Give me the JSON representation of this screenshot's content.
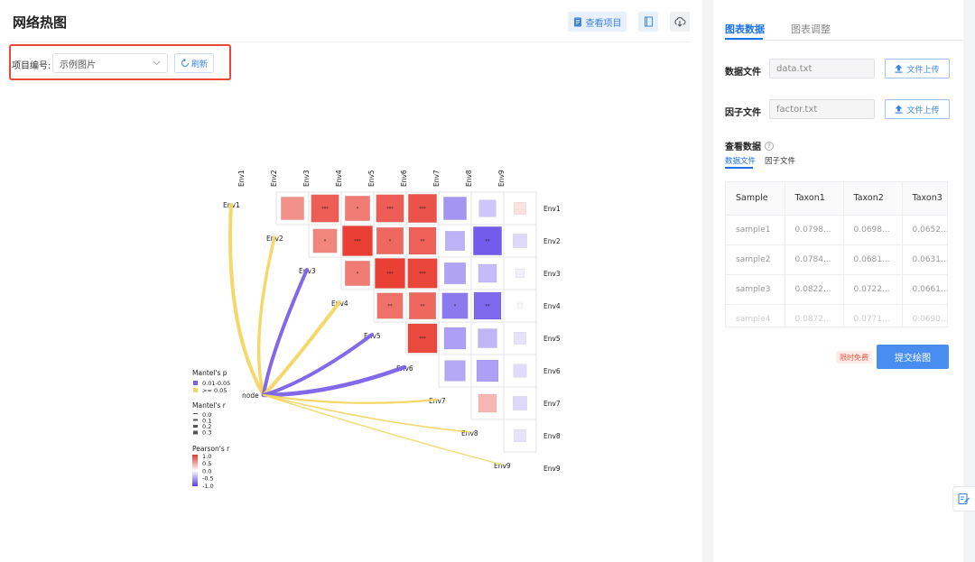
{
  "page": {
    "title": "网络热图"
  },
  "toolbar": {
    "view_project": "查看项目"
  },
  "project": {
    "label": "项目编号:",
    "selected": "示例图片",
    "refresh": "刷新"
  },
  "plot": {
    "env_labels": [
      "Env1",
      "Env2",
      "Env3",
      "Env4",
      "Env5",
      "Env6",
      "Env7",
      "Env8",
      "Env9"
    ],
    "node_label": "node",
    "legend": {
      "mantel_p_title": "Mantel's p",
      "mantel_p_items": [
        {
          "label": "0.01-0.05",
          "color": "#7b61e8"
        },
        {
          "label": ">= 0.05",
          "color": "#f5d561"
        }
      ],
      "mantel_r_title": "Mantel's r",
      "mantel_r_items": [
        "0.0",
        "0.1",
        "0.2",
        "0.3"
      ],
      "pearson_title": "Pearson's r",
      "pearson_ticks": [
        "1.0",
        "0.5",
        "0.0",
        "-0.5",
        "-1.0"
      ]
    },
    "cells": [
      {
        "row": 0,
        "col": 1,
        "r": 0.55,
        "sig": ""
      },
      {
        "row": 0,
        "col": 2,
        "r": 0.8,
        "sig": "***"
      },
      {
        "row": 0,
        "col": 3,
        "r": 0.65,
        "sig": "*"
      },
      {
        "row": 0,
        "col": 4,
        "r": 0.8,
        "sig": "***"
      },
      {
        "row": 0,
        "col": 5,
        "r": 0.85,
        "sig": "***"
      },
      {
        "row": 0,
        "col": 6,
        "r": -0.55,
        "sig": ""
      },
      {
        "row": 0,
        "col": 7,
        "r": -0.3,
        "sig": ""
      },
      {
        "row": 0,
        "col": 8,
        "r": 0.15,
        "sig": ""
      },
      {
        "row": 1,
        "col": 2,
        "r": 0.6,
        "sig": "*"
      },
      {
        "row": 1,
        "col": 3,
        "r": 0.95,
        "sig": "***"
      },
      {
        "row": 1,
        "col": 4,
        "r": 0.75,
        "sig": "*"
      },
      {
        "row": 1,
        "col": 5,
        "r": 0.78,
        "sig": "**"
      },
      {
        "row": 1,
        "col": 6,
        "r": -0.4,
        "sig": ""
      },
      {
        "row": 1,
        "col": 7,
        "r": -0.85,
        "sig": "**"
      },
      {
        "row": 1,
        "col": 8,
        "r": -0.2,
        "sig": ""
      },
      {
        "row": 2,
        "col": 3,
        "r": 0.65,
        "sig": "*"
      },
      {
        "row": 2,
        "col": 4,
        "r": 0.95,
        "sig": "***"
      },
      {
        "row": 2,
        "col": 5,
        "r": 0.92,
        "sig": "***"
      },
      {
        "row": 2,
        "col": 6,
        "r": -0.48,
        "sig": ""
      },
      {
        "row": 2,
        "col": 7,
        "r": -0.35,
        "sig": ""
      },
      {
        "row": 2,
        "col": 8,
        "r": -0.08,
        "sig": ""
      },
      {
        "row": 3,
        "col": 4,
        "r": 0.7,
        "sig": "**"
      },
      {
        "row": 3,
        "col": 5,
        "r": 0.75,
        "sig": "**"
      },
      {
        "row": 3,
        "col": 6,
        "r": -0.7,
        "sig": "*"
      },
      {
        "row": 3,
        "col": 7,
        "r": -0.78,
        "sig": "**"
      },
      {
        "row": 3,
        "col": 8,
        "r": -0.03,
        "sig": ""
      },
      {
        "row": 4,
        "col": 5,
        "r": 0.9,
        "sig": "***"
      },
      {
        "row": 4,
        "col": 6,
        "r": -0.5,
        "sig": ""
      },
      {
        "row": 4,
        "col": 7,
        "r": -0.38,
        "sig": ""
      },
      {
        "row": 4,
        "col": 8,
        "r": -0.15,
        "sig": ""
      },
      {
        "row": 5,
        "col": 6,
        "r": -0.45,
        "sig": ""
      },
      {
        "row": 5,
        "col": 7,
        "r": -0.5,
        "sig": ""
      },
      {
        "row": 5,
        "col": 8,
        "r": -0.18,
        "sig": ""
      },
      {
        "row": 6,
        "col": 7,
        "r": 0.35,
        "sig": ""
      },
      {
        "row": 6,
        "col": 8,
        "r": -0.2,
        "sig": ""
      },
      {
        "row": 7,
        "col": 8,
        "r": -0.15,
        "sig": ""
      }
    ],
    "links": [
      {
        "to": 0,
        "p": ">= 0.05",
        "r": 0.25
      },
      {
        "to": 1,
        "p": ">= 0.05",
        "r": 0.2
      },
      {
        "to": 2,
        "p": "0.01-0.05",
        "r": 0.25
      },
      {
        "to": 3,
        "p": ">= 0.05",
        "r": 0.25
      },
      {
        "to": 4,
        "p": "0.01-0.05",
        "r": 0.25
      },
      {
        "to": 5,
        "p": "0.01-0.05",
        "r": 0.3
      },
      {
        "to": 6,
        "p": ">= 0.05",
        "r": 0.1
      },
      {
        "to": 7,
        "p": ">= 0.05",
        "r": 0.05
      },
      {
        "to": 8,
        "p": ">= 0.05",
        "r": 0.02
      }
    ]
  },
  "sidebar": {
    "tabs": [
      "图表数据",
      "图表调整"
    ],
    "data_file": {
      "label": "数据文件",
      "value": "data.txt",
      "upload": "文件上传"
    },
    "factor_file": {
      "label": "因子文件",
      "value": "factor.txt",
      "upload": "文件上传"
    },
    "view_data": {
      "label": "查看数据",
      "help": "?",
      "subtabs": [
        "数据文件",
        "因子文件"
      ]
    },
    "table": {
      "headers": [
        "Sample",
        "Taxon1",
        "Taxon2",
        "Taxon3"
      ],
      "rows": [
        [
          "sample1",
          "0.0798...",
          "0.0698...",
          "0.0652..."
        ],
        [
          "sample2",
          "0.0784...",
          "0.0681...",
          "0.0631..."
        ],
        [
          "sample3",
          "0.0822...",
          "0.0722...",
          "0.0661..."
        ],
        [
          "sample4",
          "0.0872...",
          "0.0771...",
          "0.0690..."
        ]
      ]
    },
    "free_badge": "限时免费",
    "submit": "提交绘图"
  },
  "colors": {
    "accent": "#1a73e8",
    "submit": "#4a8df0",
    "highlight": "#e8493b",
    "positive": "#e8352a",
    "negative": "#5a3fe8",
    "sig_purple": "#7b61e8",
    "ns_yellow": "#f5d561"
  }
}
